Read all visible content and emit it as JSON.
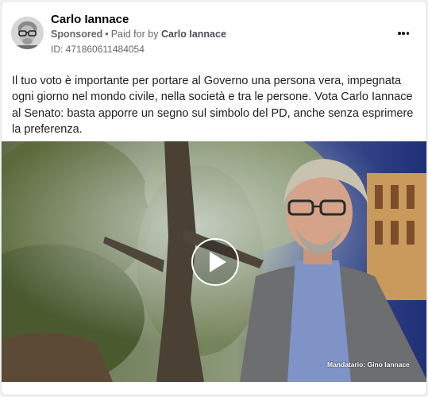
{
  "ad": {
    "advertiser_name": "Carlo Iannace",
    "sponsored_label": "Sponsored",
    "separator": "•",
    "paid_for_prefix": "Paid for by",
    "paid_for_name": "Carlo Iannace",
    "ad_id": "ID: 471860611484054",
    "body_text": "Il tuo voto è importante per portare al Governo una persona vera, impegnata ogni giorno nel mondo civile, nella società e tra le persone. Vota Carlo Iannace al Senato: basta apporre un segno sul simbolo del PD, anche senza esprimere la preferenza.",
    "video_caption": "Mandatario: Gino Iannace"
  },
  "icons": {
    "more": "more-options-icon",
    "play": "play-icon"
  },
  "colors": {
    "name": "#050505",
    "meta": "#65676b",
    "body": "#1c1e21",
    "border": "#dddfe2"
  }
}
